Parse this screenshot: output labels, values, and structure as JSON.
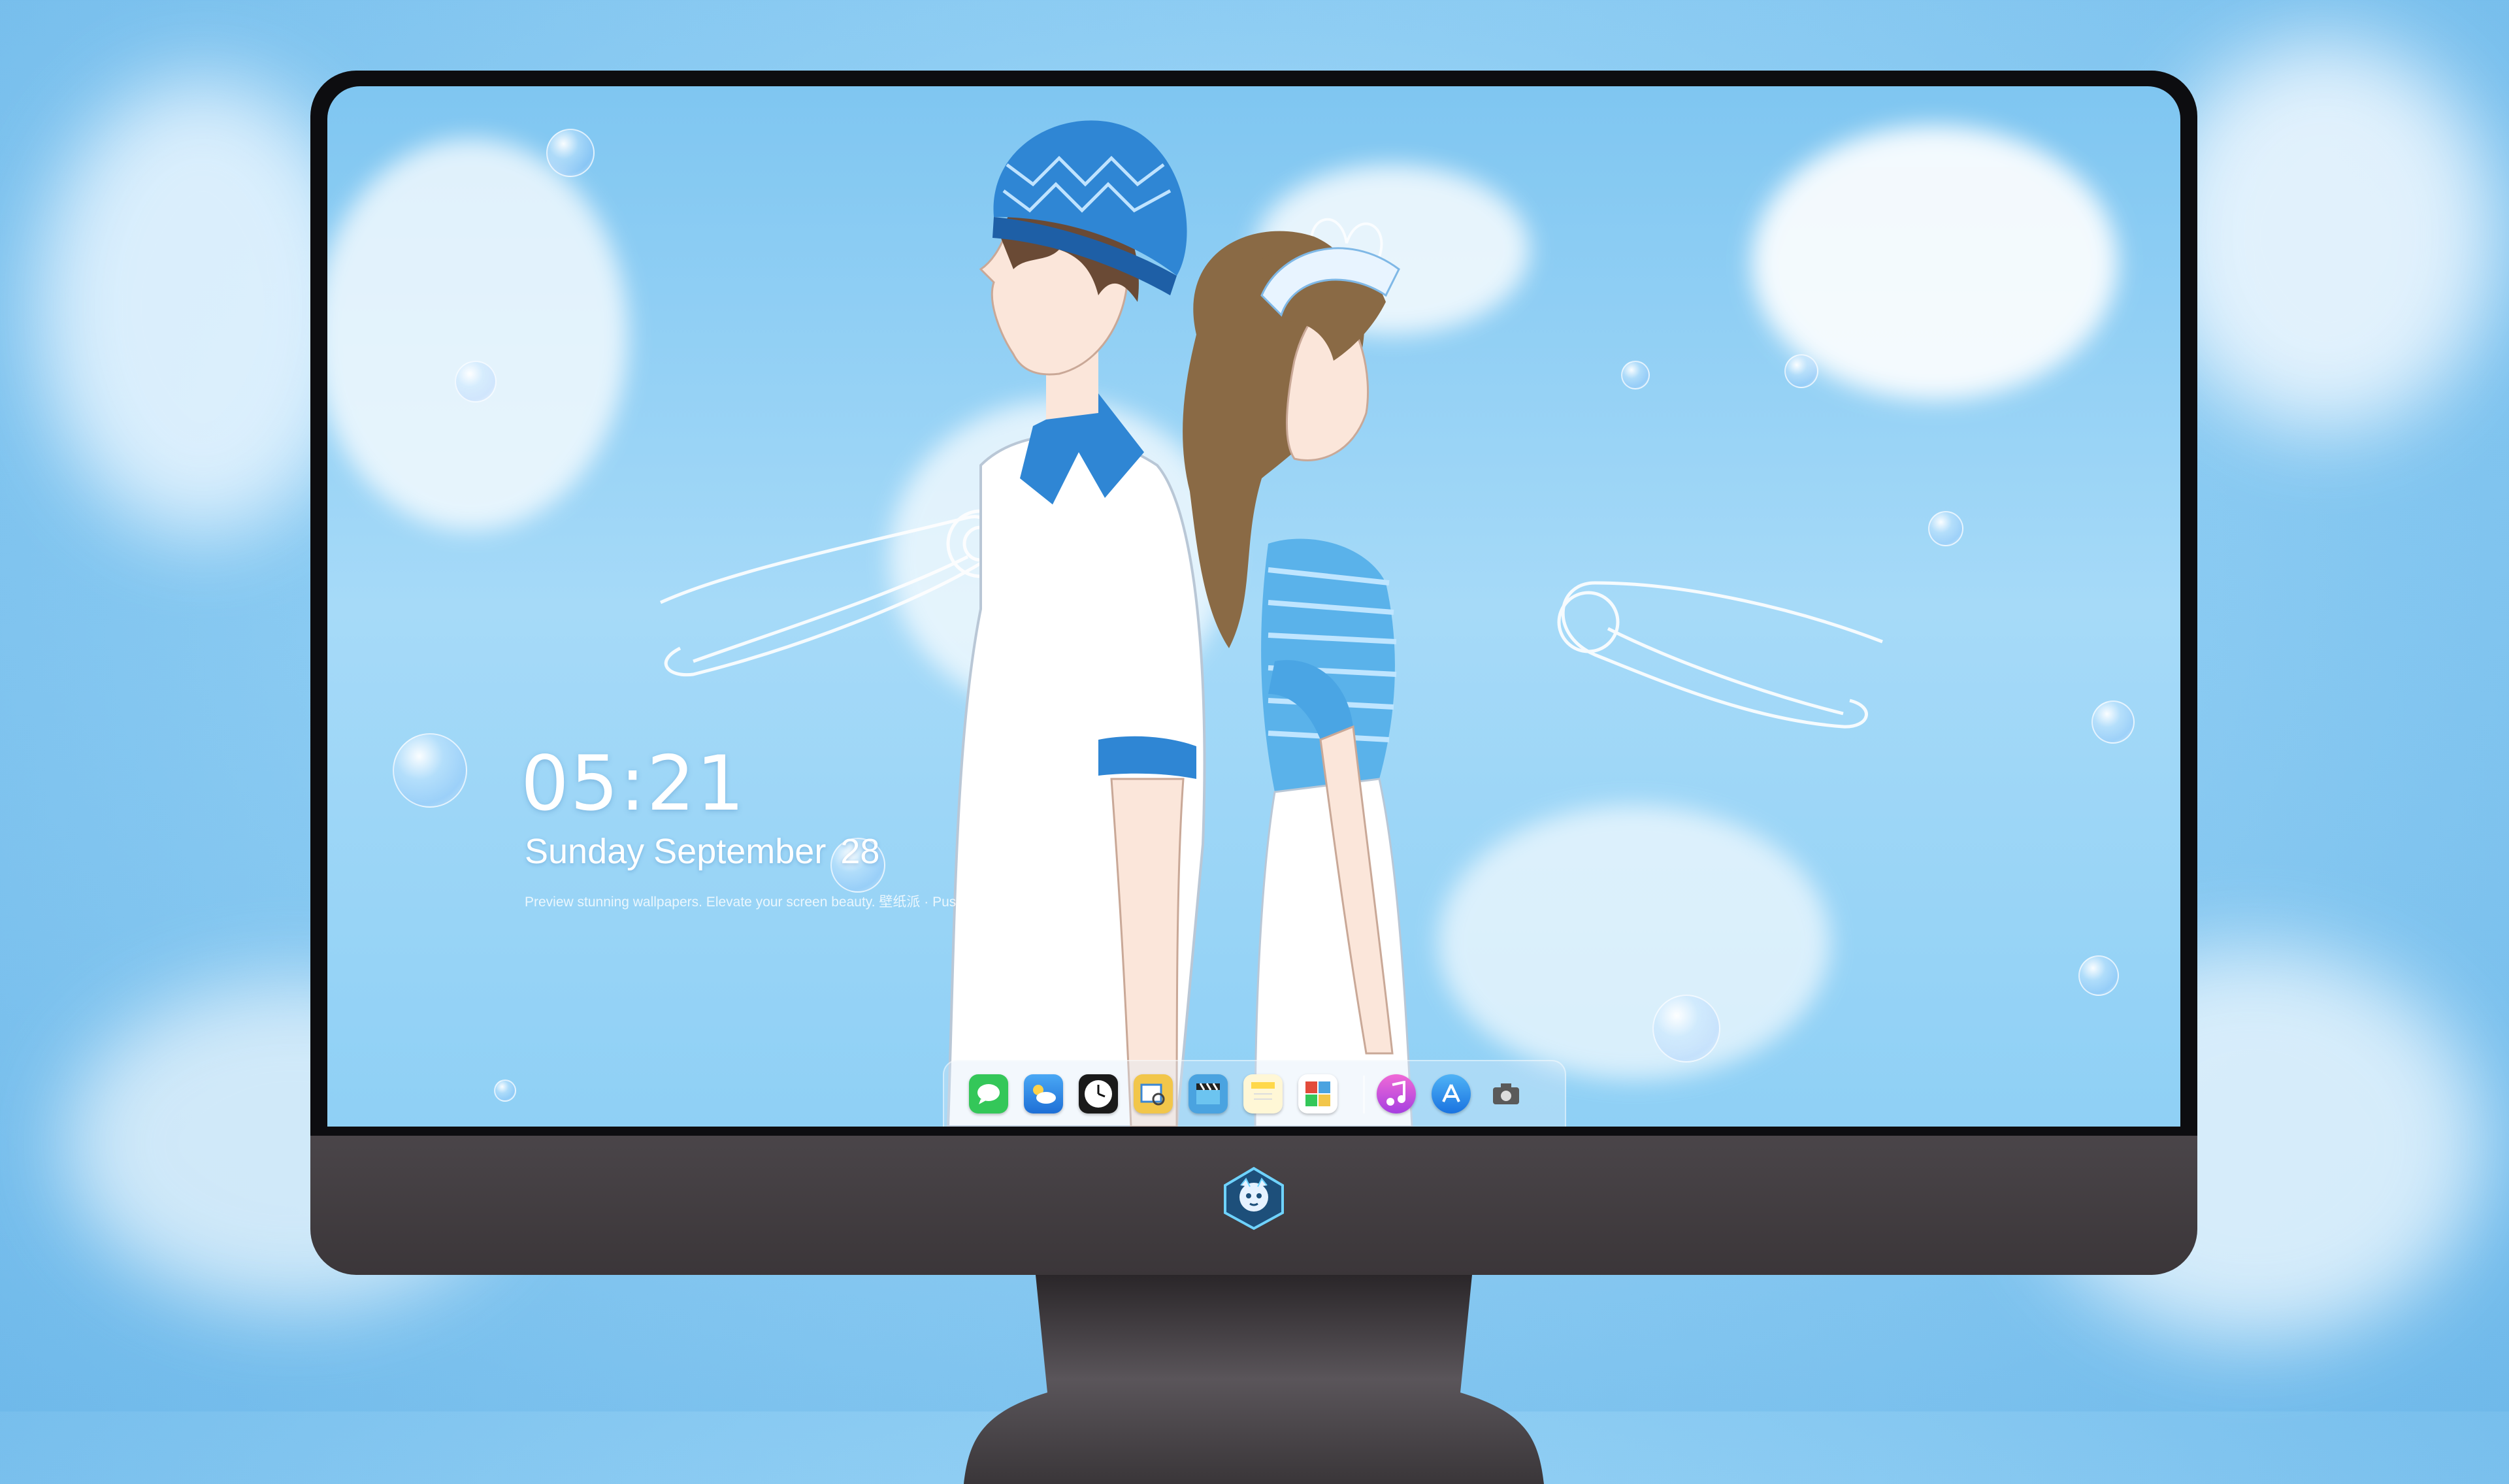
{
  "lockscreen": {
    "time": "05:21",
    "date": {
      "weekday": "Sunday",
      "month": "September",
      "day": "28"
    },
    "caption": "Preview stunning wallpapers. Elevate your screen beauty. 壁纸派 · Pushimi"
  },
  "dock": {
    "apps": [
      {
        "name": "Messages",
        "icon": "message-bubble-icon",
        "color": "#34c759"
      },
      {
        "name": "Weather",
        "icon": "weather-icon",
        "color": "#2f8ff0"
      },
      {
        "name": "Clock",
        "icon": "clock-icon",
        "color": "#1a1a1a"
      },
      {
        "name": "Preview",
        "icon": "preview-icon",
        "color": "#f2c64a"
      },
      {
        "name": "Final Cut",
        "icon": "clapper-icon",
        "color": "#4aa3e0"
      },
      {
        "name": "Notes",
        "icon": "notes-icon",
        "color": "#ffd84a"
      },
      {
        "name": "Photo Booth",
        "icon": "photo-booth-icon",
        "color": "#e24b3b"
      },
      {
        "name": "iTunes",
        "icon": "music-note-icon",
        "color": "#d94ddc"
      },
      {
        "name": "App Store",
        "icon": "app-store-icon",
        "color": "#1e88e5"
      },
      {
        "name": "Screenshot",
        "icon": "camera-icon",
        "color": "#5a5a5a"
      }
    ]
  },
  "colors": {
    "sky": "#8ecdf3",
    "bezel": "#0d0d10",
    "chin": "#3b3639",
    "text": "#ffffff"
  }
}
